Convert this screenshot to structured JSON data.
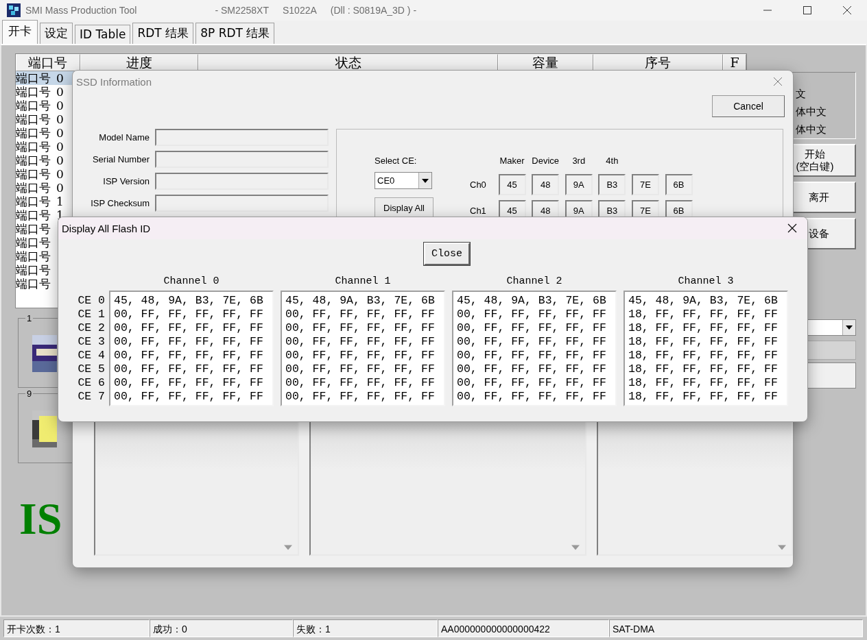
{
  "window": {
    "title": "SMI Mass Production Tool",
    "title_parts": [
      "- SM2258XT",
      "S1022A",
      "(Dll : S0819A_3D ) -"
    ]
  },
  "tabs": [
    {
      "label": "开卡",
      "selected": true
    },
    {
      "label": "设定",
      "selected": false
    },
    {
      "label": "ID Table",
      "selected": false
    },
    {
      "label": "RDT 结果",
      "selected": false
    },
    {
      "label": "8P RDT 结果",
      "selected": false
    }
  ],
  "port_table": {
    "columns": [
      "端口号",
      "进度",
      "状态",
      "容量",
      "序号",
      "F"
    ],
    "rows": [
      {
        "port": "端口号",
        "value": "0",
        "selected": true
      },
      {
        "port": "端口号",
        "value": "0",
        "selected": false
      },
      {
        "port": "端口号",
        "value": "0",
        "selected": false
      },
      {
        "port": "端口号",
        "value": "0",
        "selected": false
      },
      {
        "port": "端口号",
        "value": "0",
        "selected": false
      },
      {
        "port": "端口号",
        "value": "0",
        "selected": false
      },
      {
        "port": "端口号",
        "value": "0",
        "selected": false
      },
      {
        "port": "端口号",
        "value": "0",
        "selected": false
      },
      {
        "port": "端口号",
        "value": "0",
        "selected": false
      },
      {
        "port": "端口号",
        "value": "1",
        "selected": false
      },
      {
        "port": "端口号",
        "value": "1",
        "selected": false
      },
      {
        "port": "端口号",
        "selected": false
      },
      {
        "port": "端口号",
        "selected": false
      },
      {
        "port": "端口号",
        "selected": false
      },
      {
        "port": "端口号",
        "selected": false
      },
      {
        "port": "端口号",
        "selected": false
      }
    ]
  },
  "slots": [
    {
      "number": "1",
      "kind": "picture"
    },
    {
      "number": "9",
      "kind": "picture"
    }
  ],
  "status_code": "IS",
  "language": {
    "options": [
      "文",
      "体中文",
      "体中文"
    ]
  },
  "side_buttons": [
    {
      "lines": [
        "开始",
        "(空白键)"
      ]
    },
    {
      "lines": [
        "离开"
      ]
    },
    {
      "lines": [
        "设备"
      ]
    }
  ],
  "ssd_dialog": {
    "title": "SSD Information",
    "cancel": "Cancel",
    "fields": [
      {
        "label": "Model Name"
      },
      {
        "label": "Serial Number"
      },
      {
        "label": "ISP Version"
      },
      {
        "label": "ISP Checksum"
      }
    ],
    "select_ce": {
      "label": "Select CE:",
      "value": "CE0"
    },
    "display_all": "Display All",
    "id_columns": [
      "Maker",
      "Device",
      "3rd",
      "4th"
    ],
    "channels": [
      {
        "label": "Ch0",
        "bytes": [
          "45",
          "48",
          "9A",
          "B3",
          "7E",
          "6B"
        ]
      },
      {
        "label": "Ch1",
        "bytes": [
          "45",
          "48",
          "9A",
          "B3",
          "7E",
          "6B"
        ]
      }
    ]
  },
  "flash_dialog": {
    "title": "Display All Flash ID",
    "close": "Close",
    "ce_labels": [
      "CE 0",
      "CE 1",
      "CE 2",
      "CE 3",
      "CE 4",
      "CE 5",
      "CE 6",
      "CE 7"
    ],
    "channels": [
      {
        "name": "Channel 0",
        "lines": [
          "45, 48, 9A, B3, 7E, 6B",
          "00, FF, FF, FF, FF, FF",
          "00, FF, FF, FF, FF, FF",
          "00, FF, FF, FF, FF, FF",
          "00, FF, FF, FF, FF, FF",
          "00, FF, FF, FF, FF, FF",
          "00, FF, FF, FF, FF, FF",
          "00, FF, FF, FF, FF, FF"
        ]
      },
      {
        "name": "Channel 1",
        "lines": [
          "45, 48, 9A, B3, 7E, 6B",
          "00, FF, FF, FF, FF, FF",
          "00, FF, FF, FF, FF, FF",
          "00, FF, FF, FF, FF, FF",
          "00, FF, FF, FF, FF, FF",
          "00, FF, FF, FF, FF, FF",
          "00, FF, FF, FF, FF, FF",
          "00, FF, FF, FF, FF, FF"
        ]
      },
      {
        "name": "Channel 2",
        "lines": [
          "45, 48, 9A, B3, 7E, 6B",
          "00, FF, FF, FF, FF, FF",
          "00, FF, FF, FF, FF, FF",
          "00, FF, FF, FF, FF, FF",
          "00, FF, FF, FF, FF, FF",
          "00, FF, FF, FF, FF, FF",
          "00, FF, FF, FF, FF, FF",
          "00, FF, FF, FF, FF, FF"
        ]
      },
      {
        "name": "Channel 3",
        "lines": [
          "45, 48, 9A, B3, 7E, 6B",
          "18, FF, FF, FF, FF, FF",
          "18, FF, FF, FF, FF, FF",
          "18, FF, FF, FF, FF, FF",
          "18, FF, FF, FF, FF, FF",
          "18, FF, FF, FF, FF, FF",
          "18, FF, FF, FF, FF, FF",
          "18, FF, FF, FF, FF, FF"
        ]
      }
    ]
  },
  "status_bar": [
    "开卡次数：1",
    "成功：0",
    "失败：1",
    "AA000000000000000422",
    "SAT-DMA"
  ]
}
